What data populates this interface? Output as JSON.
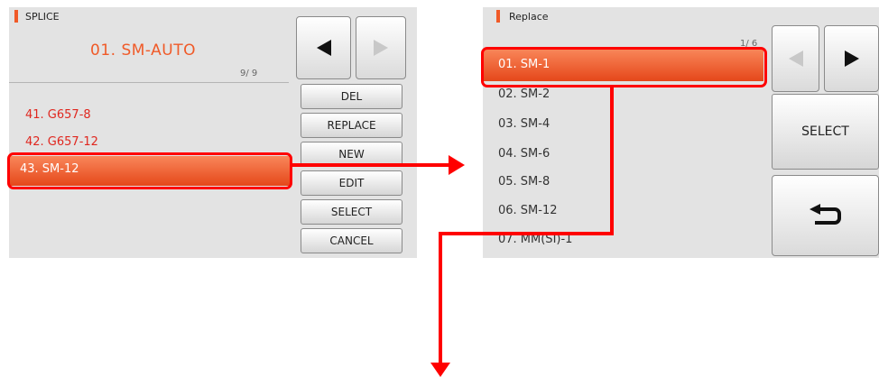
{
  "left_screen": {
    "header": "SPLICE",
    "mode_title": "01. SM-AUTO",
    "page_indicator": "9/ 9",
    "items": [
      {
        "label": "41. G657-8"
      },
      {
        "label": "42. G657-12"
      },
      {
        "label": "43. SM-12"
      }
    ],
    "buttons": {
      "prev_icon": "left-arrow-icon",
      "next_icon": "right-arrow-icon",
      "del": "DEL",
      "replace": "REPLACE",
      "new": "NEW",
      "edit": "EDIT",
      "select": "SELECT",
      "cancel": "CANCEL"
    }
  },
  "right_screen": {
    "header": "Replace",
    "page_indicator": "1/ 6",
    "items": [
      {
        "label": "01. SM-1"
      },
      {
        "label": "02. SM-2"
      },
      {
        "label": "03. SM-4"
      },
      {
        "label": "04. SM-6"
      },
      {
        "label": "05. SM-8"
      },
      {
        "label": "06. SM-12"
      },
      {
        "label": "07. MM(SI)-1"
      }
    ],
    "buttons": {
      "prev_icon": "left-arrow-icon",
      "next_icon": "right-arrow-icon",
      "select": "SELECT",
      "back_icon": "return-arrow-icon"
    }
  },
  "colors": {
    "accent": "#f05a28",
    "highlight": "#ff0000",
    "list_red": "#e0271f",
    "panel_bg": "#e3e3e3"
  }
}
